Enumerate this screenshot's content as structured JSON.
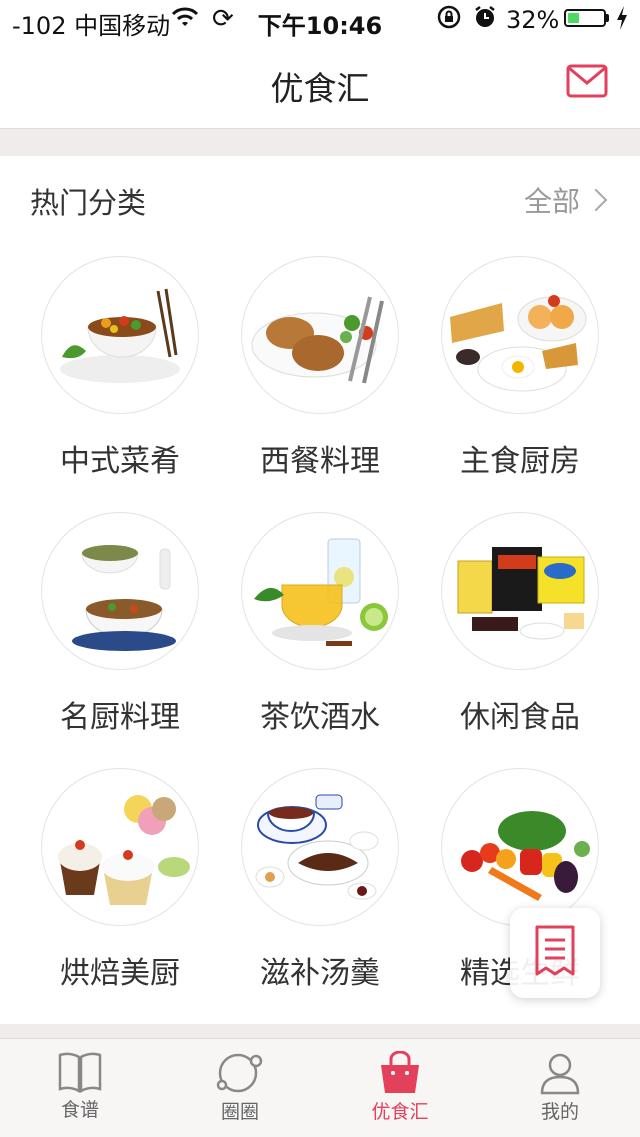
{
  "status_bar": {
    "signal": "-102 中国移动",
    "wifi_icon": "wifi-icon",
    "time": "下午10:46",
    "battery_percent": "32%",
    "battery_level": 0.32
  },
  "nav": {
    "title": "优食汇",
    "mail_icon": "mail-icon",
    "accent_color": "#e2405b"
  },
  "section": {
    "title": "热门分类",
    "see_all": "全部"
  },
  "categories": [
    {
      "label": "中式菜肴",
      "icon": "chinese-dish-image"
    },
    {
      "label": "西餐料理",
      "icon": "western-meal-image"
    },
    {
      "label": "主食厨房",
      "icon": "staple-food-image"
    },
    {
      "label": "名厨料理",
      "icon": "chef-dish-image"
    },
    {
      "label": "茶饮酒水",
      "icon": "tea-drink-image"
    },
    {
      "label": "休闲食品",
      "icon": "snack-image"
    },
    {
      "label": "烘焙美厨",
      "icon": "baking-image"
    },
    {
      "label": "滋补汤羹",
      "icon": "soup-image"
    },
    {
      "label": "精选生鲜",
      "icon": "fresh-produce-image"
    }
  ],
  "tabs": [
    {
      "label": "食谱",
      "icon": "book-icon",
      "active": false
    },
    {
      "label": "圈圈",
      "icon": "circle-icon",
      "active": false
    },
    {
      "label": "优食汇",
      "icon": "shopping-bag-icon",
      "active": true
    },
    {
      "label": "我的",
      "icon": "person-icon",
      "active": false
    }
  ]
}
